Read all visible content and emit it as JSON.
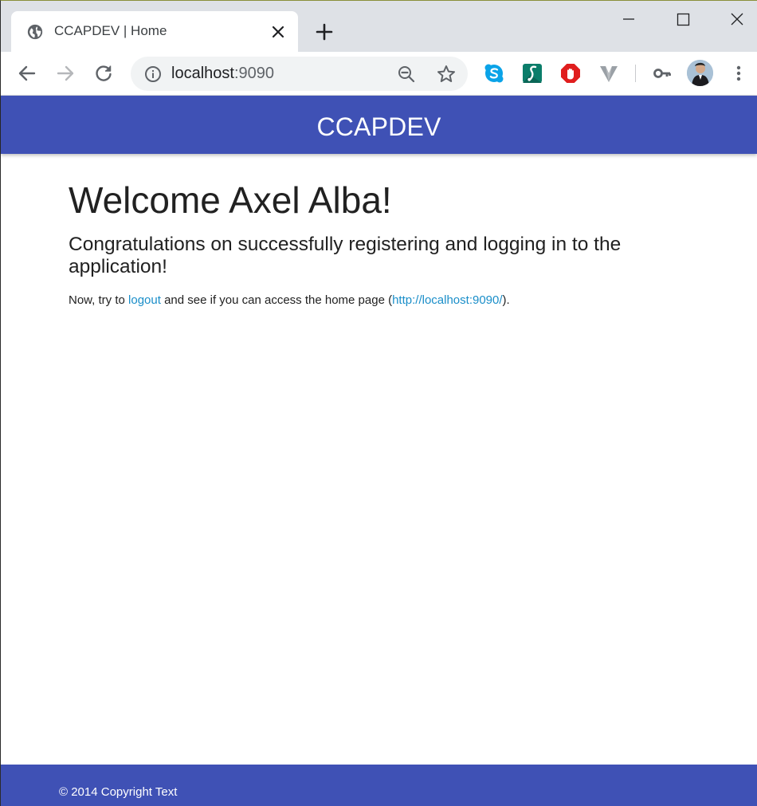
{
  "browser": {
    "tab": {
      "title": "CCAPDEV | Home",
      "favicon": "globe-icon",
      "close_icon": "close-icon"
    },
    "new_tab_icon": "plus-icon",
    "window_controls": [
      "minimize-icon",
      "maximize-icon",
      "close-icon"
    ],
    "toolbar": {
      "back_icon": "back-arrow-icon",
      "forward_icon": "forward-arrow-icon",
      "reload_icon": "reload-icon",
      "address": {
        "host": "localhost",
        "port": ":9090",
        "info_icon": "info-icon",
        "zoom_icon": "zoom-out-icon",
        "bookmark_icon": "star-icon"
      },
      "extensions": [
        "skype-icon",
        "s-extension-icon",
        "stop-hand-icon",
        "v-extension-icon"
      ],
      "key_icon": "key-icon",
      "profile": "avatar",
      "menu_icon": "kebab-menu-icon"
    }
  },
  "page": {
    "header": {
      "brand": "CCAPDEV"
    },
    "main": {
      "welcome": "Welcome Axel Alba!",
      "subtitle": "Congratulations on successfully registering and logging in to the application!",
      "note": {
        "prefix": "Now, try to ",
        "logout_link": "logout",
        "middle": " and see if you can access the home page (",
        "home_link": "http://localhost:9090/",
        "suffix": ")."
      }
    },
    "footer": {
      "copyright": "© 2014 Copyright Text"
    }
  },
  "colors": {
    "brand": "#3f51b5",
    "link": "#1a8ec9",
    "tabstrip": "#dee1e6",
    "omnibox": "#f1f3f4"
  }
}
